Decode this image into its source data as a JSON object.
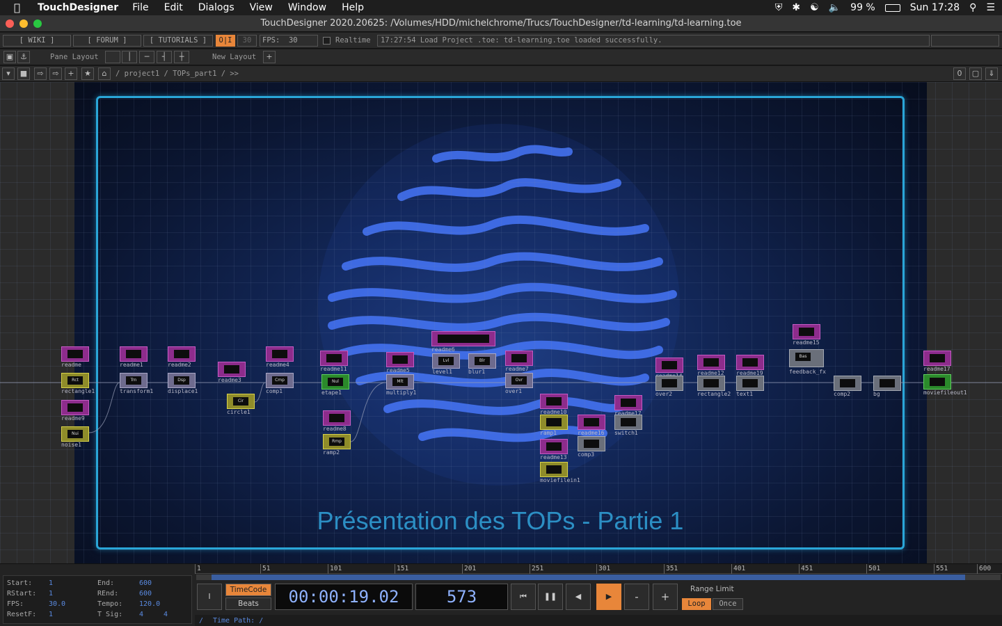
{
  "menubar": {
    "app_name": "TouchDesigner",
    "items": [
      "File",
      "Edit",
      "Dialogs",
      "View",
      "Window",
      "Help"
    ],
    "battery": "99 %",
    "clock": "Sun 17:28"
  },
  "window": {
    "title": "TouchDesigner 2020.20625: /Volumes/HDD/michelchrome/Trucs/TouchDesigner/td-learning/td-learning.toe"
  },
  "toolbar1": {
    "wiki": "[ WIKI ]",
    "forum": "[ FORUM ]",
    "tutorials": "[ TUTORIALS ]",
    "oi": "O|I",
    "fps_limit": "30",
    "fps_label": "FPS:",
    "fps_value": "30",
    "realtime_label": "Realtime",
    "status": "17:27:54 Load Project .toe: td-learning.toe loaded successfully."
  },
  "toolbar2": {
    "pane_layout": "Pane Layout",
    "new_layout": "New Layout",
    "add": "+"
  },
  "toolbar3": {
    "path": "/ project1 / TOPs_part1 / >>",
    "counter": "0",
    "add": "+"
  },
  "network": {
    "slide_title": "Présentation des TOPs - Partie 1",
    "nodes": [
      {
        "label": "readme",
        "glyph": "",
        "kind": "dat"
      },
      {
        "label": "rectangle1",
        "glyph": "Rct",
        "kind": "sel"
      },
      {
        "label": "readme9",
        "glyph": "",
        "kind": "dat"
      },
      {
        "label": "noise1",
        "glyph": "Nui",
        "kind": "sel"
      },
      {
        "label": "readme1",
        "glyph": "",
        "kind": "dat"
      },
      {
        "label": "transform1",
        "glyph": "Trn",
        "kind": "top"
      },
      {
        "label": "readme2",
        "glyph": "",
        "kind": "dat"
      },
      {
        "label": "displace1",
        "glyph": "Dsp",
        "kind": "top"
      },
      {
        "label": "readme3",
        "glyph": "",
        "kind": "dat"
      },
      {
        "label": "circle1",
        "glyph": "Cir",
        "kind": "sel"
      },
      {
        "label": "readme4",
        "glyph": "",
        "kind": "dat"
      },
      {
        "label": "comp1",
        "glyph": "Cmp",
        "kind": "top"
      },
      {
        "label": "readme11",
        "glyph": "",
        "kind": "dat"
      },
      {
        "label": "etape1",
        "glyph": "Nul",
        "kind": "grn"
      },
      {
        "label": "readme8",
        "glyph": "",
        "kind": "dat"
      },
      {
        "label": "ramp2",
        "glyph": "Rmp",
        "kind": "sel"
      },
      {
        "label": "readme5",
        "glyph": "",
        "kind": "dat"
      },
      {
        "label": "multiply1",
        "glyph": "Mlt",
        "kind": "top"
      },
      {
        "label": "readme6",
        "glyph": "",
        "kind": "dat"
      },
      {
        "label": "level1",
        "glyph": "Lvl",
        "kind": "top"
      },
      {
        "label": "blur1",
        "glyph": "Blr",
        "kind": "top"
      },
      {
        "label": "readme7",
        "glyph": "",
        "kind": "dat"
      },
      {
        "label": "over1",
        "glyph": "Ovr",
        "kind": "top"
      },
      {
        "label": "readme10",
        "glyph": "",
        "kind": "dat"
      },
      {
        "label": "ramp1",
        "glyph": "",
        "kind": "sel"
      },
      {
        "label": "readme13",
        "glyph": "",
        "kind": "dat"
      },
      {
        "label": "moviefilein1",
        "glyph": "",
        "kind": "sel"
      },
      {
        "label": "readme16",
        "glyph": "",
        "kind": "dat"
      },
      {
        "label": "comp3",
        "glyph": "",
        "kind": "gray"
      },
      {
        "label": "readme17",
        "glyph": "",
        "kind": "dat"
      },
      {
        "label": "switch1",
        "glyph": "",
        "kind": "gray"
      },
      {
        "label": "readme14",
        "glyph": "",
        "kind": "dat"
      },
      {
        "label": "over2",
        "glyph": "",
        "kind": "gray"
      },
      {
        "label": "readme12",
        "glyph": "",
        "kind": "dat"
      },
      {
        "label": "rectangle2",
        "glyph": "",
        "kind": "gray"
      },
      {
        "label": "readme19",
        "glyph": "",
        "kind": "dat"
      },
      {
        "label": "text1",
        "glyph": "",
        "kind": "gray"
      },
      {
        "label": "readme15",
        "glyph": "",
        "kind": "dat"
      },
      {
        "label": "feedback_fx",
        "glyph": "Bas",
        "kind": "gray"
      },
      {
        "label": "comp2",
        "glyph": "",
        "kind": "gray"
      },
      {
        "label": "bg",
        "glyph": "",
        "kind": "gray"
      },
      {
        "label": "readme17",
        "glyph": "",
        "kind": "dat"
      },
      {
        "label": "moviefileout1",
        "glyph": "",
        "kind": "grn"
      }
    ]
  },
  "timeline": {
    "ticks": [
      "1",
      "51",
      "101",
      "151",
      "201",
      "251",
      "301",
      "351",
      "401",
      "451",
      "501",
      "551",
      "600"
    ],
    "progress_frame": 573,
    "range_end": 600,
    "info": {
      "start_label": "Start:",
      "start": "1",
      "end_label": "End:",
      "end": "600",
      "rstart_label": "RStart:",
      "rstart": "1",
      "rend_label": "REnd:",
      "rend": "600",
      "fps_label": "FPS:",
      "fps": "30.0",
      "tempo_label": "Tempo:",
      "tempo": "120.0",
      "resetf_label": "ResetF:",
      "resetf": "1",
      "tsig_label": "T Sig:",
      "tsig_a": "4",
      "tsig_b": "4"
    },
    "timecode_btn": "TimeCode",
    "beats_btn": "Beats",
    "timecode": "00:00:19.02",
    "frame": "573",
    "minus": "-",
    "plus": "+",
    "range_limit_label": "Range Limit",
    "loop_btn": "Loop",
    "once_btn": "Once",
    "time_path": "Time Path: /",
    "slash": "/",
    "i_btn": "I"
  },
  "colors": {
    "accent_orange": "#e8863a",
    "frame_blue": "#2aa6d8",
    "digit_blue": "#8fb2ff"
  }
}
